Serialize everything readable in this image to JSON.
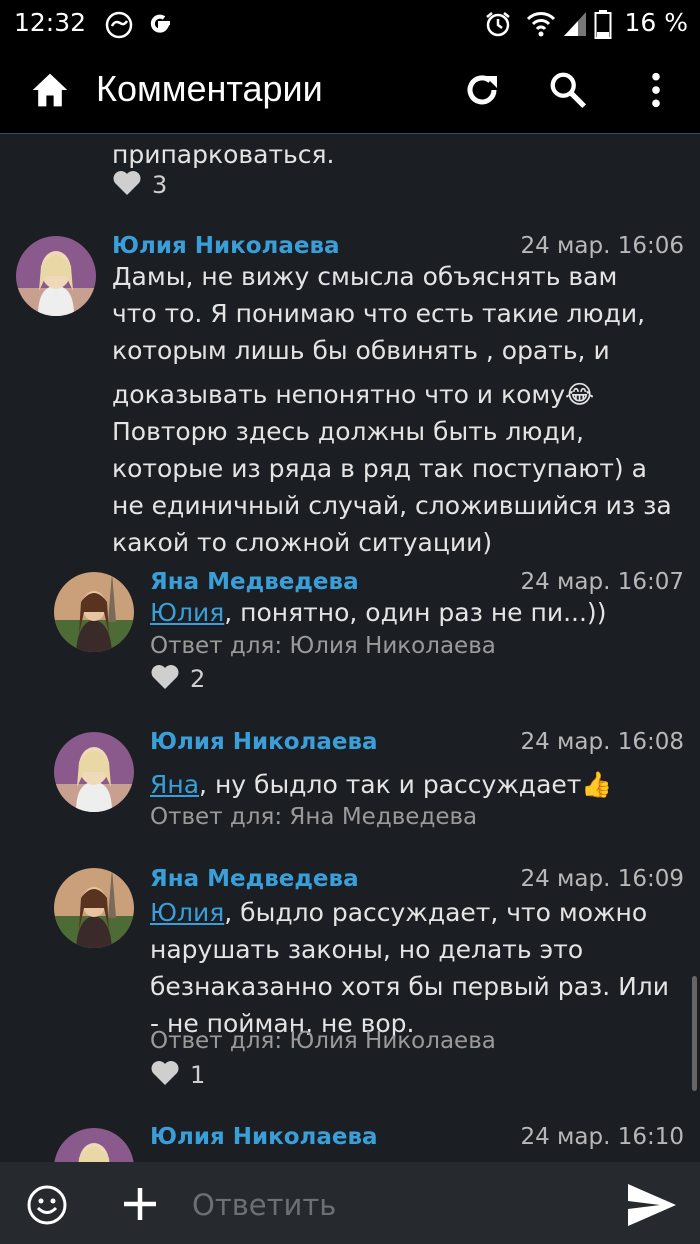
{
  "status_bar": {
    "time": "12:32",
    "battery": "16 %"
  },
  "app_bar": {
    "title": "Комментарии"
  },
  "comments": [
    {
      "text_tail": "припарковаться.",
      "likes": "3"
    },
    {
      "author": "Юлия Николаева",
      "date": "24 мар. 16:06",
      "lines": [
        "Дамы, не вижу смысла объяснять вам",
        "что то. Я понимаю что есть такие люди,",
        "которым лишь бы обвинять , орать, и",
        "доказывать непонятно что и кому😂",
        "Повторю здесь должны быть люди,",
        "которые из ряда в ряд так поступают) а",
        "не единичный случай, сложившийся из за",
        "какой то сложной ситуации)"
      ]
    },
    {
      "author": "Яна Медведева",
      "date": "24 мар. 16:07",
      "mention": "Юлия",
      "text": ", понятно, один раз не пи...))",
      "reply_to": "Ответ для: Юлия Николаева",
      "likes": "2"
    },
    {
      "author": "Юлия Николаева",
      "date": "24 мар. 16:08",
      "mention": "Яна",
      "text": ", ну быдло так и рассуждает👍",
      "reply_to": "Ответ для: Яна Медведева"
    },
    {
      "author": "Яна Медведева",
      "date": "24 мар. 16:09",
      "mention": "Юлия",
      "text_first": ", быдло рассуждает, что можно",
      "lines": [
        "нарушать законы, но делать это",
        "безнаказанно хотя бы первый раз. Или",
        "- не пойман, не вор."
      ],
      "reply_to": "Ответ для: Юлия Николаева",
      "likes": "1"
    },
    {
      "author": "Юлия Николаева",
      "date": "24 мар. 16:10"
    }
  ],
  "composer": {
    "placeholder": "Ответить"
  },
  "colors": {
    "accent": "#3a9fd8",
    "background": "#1b1e22",
    "bar": "#000000"
  }
}
